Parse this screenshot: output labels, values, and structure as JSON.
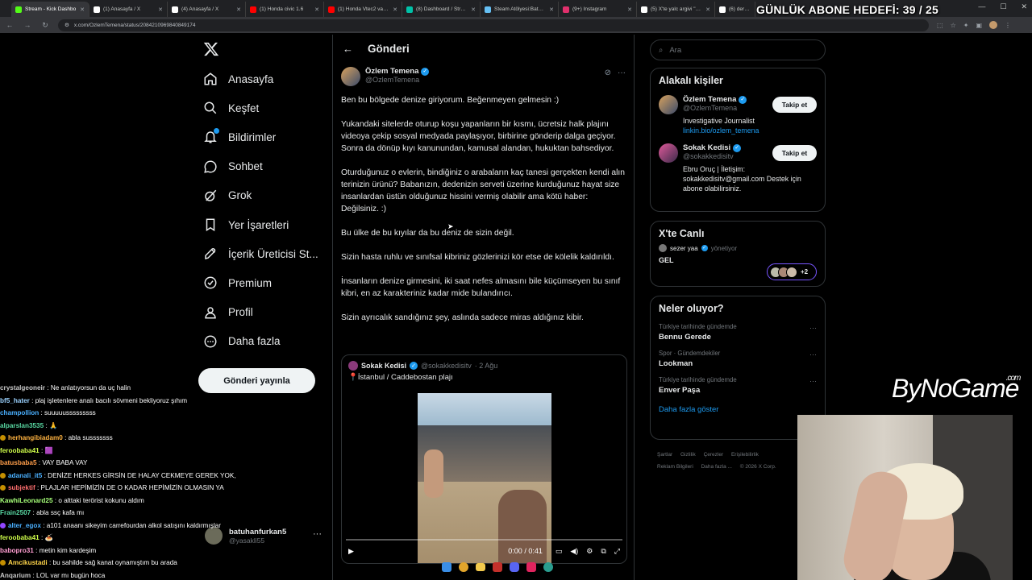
{
  "browser": {
    "tabs": [
      {
        "label": "Stream - Kick Dashbo",
        "favicon_color": "#53fc18"
      },
      {
        "label": "(1) Anasayfa / X",
        "favicon_color": "#ffffff"
      },
      {
        "label": "(4) Anasayfa / X",
        "favicon_color": "#ffffff"
      },
      {
        "label": "(1) Honda civic 1.6",
        "favicon_color": "#ff0000"
      },
      {
        "label": "(1) Honda Vtec2 varen",
        "favicon_color": "#ff0000"
      },
      {
        "label": "(8) Dashboard / Stream",
        "favicon_color": "#00c2a8"
      },
      {
        "label": "Steam Atölyesi:Batuha",
        "favicon_color": "#1b2838"
      },
      {
        "label": "(9+) Instagram",
        "favicon_color": "#e1306c"
      },
      {
        "label": "(5) X'te yalc argivi \"deri",
        "favicon_color": "#ffffff"
      },
      {
        "label": "(6) derbederbe",
        "favicon_color": "#ffffff"
      }
    ],
    "url": "x.com/OzlemTemena/status/2084210969840849174"
  },
  "overlay": {
    "sub_goal": "GÜNLÜK ABONE HEDEFİ: 39 / 25",
    "brand": "ByNoGame",
    "brand_suffix": ".com"
  },
  "nav": {
    "items": [
      {
        "label": "Anasayfa",
        "icon": "home-icon"
      },
      {
        "label": "Keşfet",
        "icon": "search-icon"
      },
      {
        "label": "Bildirimler",
        "icon": "bell-icon"
      },
      {
        "label": "Sohbet",
        "icon": "chat-icon"
      },
      {
        "label": "Grok",
        "icon": "grok-icon"
      },
      {
        "label": "Yer İşaretleri",
        "icon": "bookmark-icon"
      },
      {
        "label": "İçerik Üreticisi St...",
        "icon": "rocket-icon"
      },
      {
        "label": "Premium",
        "icon": "premium-icon"
      },
      {
        "label": "Profil",
        "icon": "person-icon"
      },
      {
        "label": "Daha fazla",
        "icon": "more-icon"
      }
    ],
    "post_button": "Gönderi yayınla",
    "account_name": "batuhanfurkan5",
    "account_handle": "@yasakli55"
  },
  "chat": [
    {
      "user": "crystalgeoneir",
      "text": "Ne anlatıyorsun da uç halin",
      "color": "#c8c8c8"
    },
    {
      "user": "bf5_hater",
      "text": "plaj işletenlere analı bacılı sövmeni bekliyoruz şıhım",
      "color": "#9bd2ff"
    },
    {
      "user": "champollion",
      "text": "suuuuusssssssss",
      "color": "#4ab0ff"
    },
    {
      "user": "alparslan3535",
      "text": "🙏",
      "color": "#59d9a3"
    },
    {
      "user": "herhangibiadam0",
      "text": "abla susssssss",
      "color": "#ffb341"
    },
    {
      "user": "feroobaba41",
      "text": "🟪",
      "color": "#d0ff4a"
    },
    {
      "user": "batusbaba5",
      "text": "VAY BABA VAY",
      "color": "#ff9e4a"
    },
    {
      "user": "adanali_it5",
      "text": "DENİZE HERKES GİRSİN DE HALAY CEKMEYE GEREK YOK,",
      "color": "#4ab0ff"
    },
    {
      "user": "subjektif",
      "text": "PLAJLAR HEPİMİZİN DE O KADAR HEPİMİZİN OLMASIN YA",
      "color": "#ff6f6f"
    },
    {
      "user": "KawhiLeonard25",
      "text": "o alttaki terörist kokunu aldım",
      "color": "#a6ff78"
    },
    {
      "user": "Frain2507",
      "text": "abla ssç kafa mı",
      "color": "#59d9a3"
    },
    {
      "user": "alter_egox",
      "text": "a101 anaanı sikeyim carrefourdan alkol satışını kaldırmışlar",
      "color": "#4ab0ff"
    },
    {
      "user": "feroobaba41",
      "text": "🍝",
      "color": "#d0ff4a"
    },
    {
      "user": "babopro31",
      "text": "metin kim kardeşim",
      "color": "#ff9ed2"
    },
    {
      "user": "Amcikustadi",
      "text": "bu sahilde sağ kanat oynamıştım bu arada",
      "color": "#ffd54a"
    },
    {
      "user": "Anqarium",
      "text": "LOL var mı bugün hoca",
      "color": "#c8c8c8"
    }
  ],
  "post": {
    "header_title": "Gönderi",
    "author_name": "Özlem Temena",
    "author_handle": "@OzlemTemena",
    "paragraphs": [
      "Ben bu bölgede denize giriyorum. Beğenmeyen gelmesin :)",
      "Yukandaki sitelerde oturup koşu yapanların bir kısmı, ücretsiz halk plajını videoya çekip sosyal medyada paylaşıyor, birbirine gönderip dalga geçiyor. Sonra da dönüp kıyı kanunundan, kamusal alandan, hukuktan bahsediyor.",
      "Oturduğunuz o evlerin, bindiğiniz o arabaların kaç tanesi gerçekten kendi alın terinizin ürünü? Babanızın, dedenizin serveti üzerine kurduğunuz hayat size insanlardan üstün olduğunuz hissini vermiş olabilir ama kötü haber: Değilsiniz. :)",
      "Bu ülke de bu kıyılar da bu deniz de sizin değil.",
      "Sizin hasta ruhlu ve sınıfsal kibriniz gözlerinizi kör etse de kölelik kaldırıldı.",
      "İnsanların denize girmesini, iki saat nefes almasını bile küçümseyen bu sınıf kibri, en az karakteriniz kadar mide bulandırıcı.",
      "Sizin ayrıcalık sandığınız şey, aslında sadece miras aldığınız kibir."
    ],
    "quote": {
      "author_name": "Sokak Kedisi",
      "author_handle": "@sokakkedisitv",
      "date": "· 2 Ağu",
      "text": "📍İstanbul / Caddebostan plajı",
      "video_time": "0:00 / 0:41"
    }
  },
  "right": {
    "search_placeholder": "Ara",
    "related_title": "Alakalı kişiler",
    "people": [
      {
        "name": "Özlem Temena",
        "handle": "@OzlemTemena",
        "bio": "Investigative Journalist",
        "link": "linkin.bio/ozlem_temena",
        "follow": "Takip et"
      },
      {
        "name": "Sokak Kedisi",
        "handle": "@sokakkedisitv",
        "bio": "Ebru Oruç | İletişim: sokakkedisitv@gmail.com Destek için abone olabilirsiniz.",
        "link": "",
        "follow": "Takip et"
      }
    ],
    "live_title": "X'te Canlı",
    "live_host": "sezer yaa",
    "live_role": "yönetiyor",
    "live_space": "GEL",
    "live_extra": "+2",
    "trends_title": "Neler oluyor?",
    "trends": [
      {
        "context": "Türkiye tarihinde gündemde",
        "name": "Bennu Gerede"
      },
      {
        "context": "Spor · Gündemdekiler",
        "name": "Lookman"
      },
      {
        "context": "Türkiye tarihinde gündemde",
        "name": "Enver Paşa"
      }
    ],
    "show_more": "Daha fazla göster",
    "footer": [
      "Şartlar",
      "Gizlilik",
      "Çerezler",
      "Erişilebilirlik",
      "Reklam Bilgileri",
      "Daha fazla ...",
      "© 2026 X Corp."
    ]
  }
}
